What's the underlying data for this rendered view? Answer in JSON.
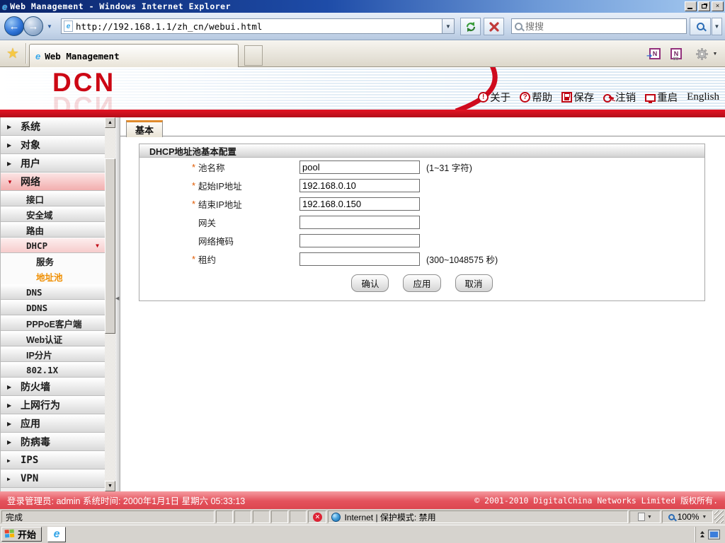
{
  "colors": {
    "brand_red": "#cc0714",
    "active_menu_orange": "#ef8e00",
    "footer_red": "#e4525c",
    "tab_accent_orange": "#e08b2d"
  },
  "browser": {
    "window_title": "Web Management - Windows Internet Explorer",
    "url": "http://192.168.1.1/zh_cn/webui.html",
    "search_placeholder": "搜搜",
    "tab_title": "Web Management",
    "status": {
      "done": "完成",
      "zone": "Internet | 保护模式: 禁用",
      "zoom": "100%"
    }
  },
  "header": {
    "logo": "DCN",
    "links": [
      {
        "label": "关于",
        "icon": "about-icon"
      },
      {
        "label": "帮助",
        "icon": "help-icon"
      },
      {
        "label": "保存",
        "icon": "save-icon"
      },
      {
        "label": "注销",
        "icon": "logout-icon"
      },
      {
        "label": "重启",
        "icon": "restart-icon"
      },
      {
        "label": "English"
      }
    ]
  },
  "sidebar": {
    "items": [
      {
        "label": "系统",
        "level": 1,
        "state": "collapsed"
      },
      {
        "label": "对象",
        "level": 1,
        "state": "collapsed"
      },
      {
        "label": "用户",
        "level": 1,
        "state": "collapsed"
      },
      {
        "label": "网络",
        "level": 1,
        "state": "expanded-selected"
      },
      {
        "label": "接口",
        "level": 2
      },
      {
        "label": "安全域",
        "level": 2
      },
      {
        "label": "路由",
        "level": 2
      },
      {
        "label": "DHCP",
        "level": 2,
        "state": "expanded"
      },
      {
        "label": "服务",
        "level": 3
      },
      {
        "label": "地址池",
        "level": 3,
        "state": "active"
      },
      {
        "label": "DNS",
        "level": 2
      },
      {
        "label": "DDNS",
        "level": 2
      },
      {
        "label": "PPPoE客户端",
        "level": 2
      },
      {
        "label": "Web认证",
        "level": 2
      },
      {
        "label": "IP分片",
        "level": 2
      },
      {
        "label": "802.1X",
        "level": 2
      },
      {
        "label": "防火墙",
        "level": 1,
        "state": "collapsed"
      },
      {
        "label": "上网行为",
        "level": 1,
        "state": "collapsed"
      },
      {
        "label": "应用",
        "level": 1,
        "state": "collapsed"
      },
      {
        "label": "防病毒",
        "level": 1,
        "state": "collapsed"
      },
      {
        "label": "IPS",
        "level": 1,
        "state": "collapsed"
      },
      {
        "label": "VPN",
        "level": 1,
        "state": "collapsed"
      }
    ]
  },
  "main": {
    "tab_label": "基本",
    "section_title": "DHCP地址池基本配置",
    "form": {
      "rows": [
        {
          "label": "池名称",
          "required": true,
          "value": "pool",
          "hint": "(1~31 字符)"
        },
        {
          "label": "起始IP地址",
          "required": true,
          "value": "192.168.0.10",
          "hint": ""
        },
        {
          "label": "结束IP地址",
          "required": true,
          "value": "192.168.0.150",
          "hint": ""
        },
        {
          "label": "网关",
          "required": false,
          "value": "",
          "hint": ""
        },
        {
          "label": "网络掩码",
          "required": false,
          "value": "",
          "hint": ""
        },
        {
          "label": "租约",
          "required": true,
          "value": "",
          "hint": "(300~1048575 秒)"
        }
      ],
      "buttons": [
        "确认",
        "应用",
        "取消"
      ]
    }
  },
  "footer": {
    "login": "登录管理员: admin 系统时间: 2000年1月1日 星期六 05:33:13",
    "copyright": "© 2001-2010 DigitalChina Networks Limited 版权所有."
  },
  "taskbar": {
    "start_label": "开始"
  }
}
